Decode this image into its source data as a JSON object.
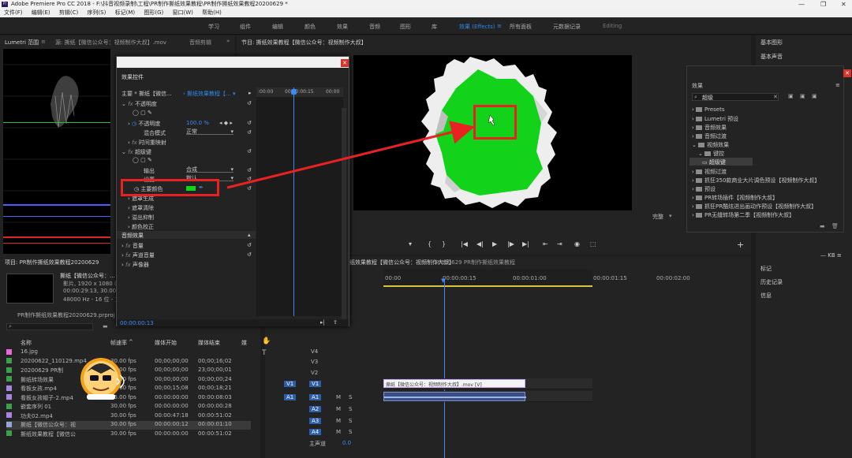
{
  "window": {
    "app": "Adobe Premiere Pro CC 2018",
    "path": "F:\\抖音视频录制\\工程\\PR制作撕纸效果教程\\PR制作撕纸效果教程20200629 *"
  },
  "menu": [
    "文件(F)",
    "编辑(E)",
    "剪辑(C)",
    "序列(S)",
    "标记(M)",
    "图形(G)",
    "窗口(W)",
    "帮助(H)"
  ],
  "workspaces": [
    "学习",
    "组件",
    "编辑",
    "颜色",
    "效果",
    "音频",
    "图形",
    "库",
    "效果 (Effects)",
    "所有面板",
    "元数据记录",
    "Editing"
  ],
  "workspace_active": "效果 (Effects)",
  "left_panel": {
    "tab_scope": "Lumetri 范围",
    "tab_source": "源: 撕纸【微信公众号：视频制作大叔】.mov",
    "tab_audio_mixer": "音频剪辑"
  },
  "program_monitor": {
    "tab": "节目: 撕纸效果教程【微信公众号：视频制作大叔】",
    "quality": "完整"
  },
  "right_panel": {
    "basic_graphics": "基本图形",
    "basic_sound": "基本声音",
    "markers": "标记",
    "history": "历史记录",
    "info": "信息",
    "kb": "KB"
  },
  "effect_controls": {
    "title": "效果控件",
    "master": "主要 * 撕纸【微信...",
    "sequence": "撕纸效果教程【...",
    "ruler_start": ":00:00",
    "ruler_mid": "00:00:00:15",
    "ruler_end": "00:00",
    "rows": {
      "opacity": "不透明度",
      "opacity_label": "不透明度",
      "opacity_value": "100.0 %",
      "blend": "混合模式",
      "blend_value": "正常",
      "time_remap": "时间重映射",
      "ultra_key": "超级键",
      "output": "输出",
      "output_value": "合成",
      "settings": "设置",
      "settings_value": "默认",
      "key_color": "主要颜色",
      "matte_gen": "遮罩生成",
      "matte_clean": "遮罩清除",
      "spill": "溢出抑制",
      "color_correct": "颜色校正",
      "audio_fx": "音频效果",
      "volume": "音量",
      "channel_volume": "声道音量",
      "panner": "声像器"
    },
    "timecode": "00:00:00:13"
  },
  "effects_panel": {
    "title": "效果",
    "search_value": "超级",
    "items": [
      "Presets",
      "Lumetri 预设",
      "音频效果",
      "音频过渡",
      "视频效果",
      "键控",
      "超级键",
      "视频过渡",
      "抓狂350款商业大片调色预设【视频制作大叔】",
      "预设",
      "PR转场插件【视频制作大叔】",
      "抓狂PR酷炫进出画动作预设【视频制作大叔】",
      "PR无缝转场第二季【视频制作大叔】"
    ]
  },
  "project": {
    "tab": "项目: PR制作撕纸效果教程20200629",
    "clip_name": "撕纸【微信公众号：...",
    "clip_info1": "影片, 1920 x 1080 (1.0)",
    "clip_info2": "00:00:29:13, 30.00p",
    "clip_info3": "48000 Hz - 16 位 - 立体",
    "prproj": "PR制作撕纸效果教程20200629.prproj",
    "col_name": "名称",
    "col_fps": "帧速率",
    "col_start": "媒体开始",
    "col_end": "媒体结束",
    "col_more": "媒",
    "rows": [
      {
        "color": "#e86ad6",
        "name": "16.jpg",
        "fps": "",
        "start": "",
        "end": ""
      },
      {
        "color": "#3aa04a",
        "name": "20200622_110129.mp4",
        "fps": "30.00 fps",
        "start": "00;00;00;00",
        "end": "00;00;16;02"
      },
      {
        "color": "#3aa04a",
        "name": "20200629 PR制",
        "fps": "30.00 fps",
        "start": "00;00;00;00",
        "end": "23;00;00;01"
      },
      {
        "color": "#3aa04a",
        "name": "撕纸转场效果",
        "fps": "30.00 fps",
        "start": "00;00;00;00",
        "end": "00;00;00;24"
      },
      {
        "color": "#a884e0",
        "name": "看板女孩.mp4",
        "fps": "30.00 fps",
        "start": "00;00;15;08",
        "end": "00;00;18;21"
      },
      {
        "color": "#a884e0",
        "name": "看板女孩帽子-2.mp4",
        "fps": "25.00 fps",
        "start": "00:00:00:00",
        "end": "00:00:08:03"
      },
      {
        "color": "#3aa04a",
        "name": "嵌套序列 01",
        "fps": "30.00 fps",
        "start": "00:00:00:00",
        "end": "00:00:00:28"
      },
      {
        "color": "#a884e0",
        "name": "功夫02.mp4",
        "fps": "30.00 fps",
        "start": "00:00:47:18",
        "end": "00:00:51:02"
      },
      {
        "color": "#8fa8d8",
        "name": "撕纸【微信公众号：视",
        "fps": "30.00 fps",
        "start": "00:00:00:12",
        "end": "00:00:01:10"
      },
      {
        "color": "#3aa04a",
        "name": "撕纸效果教程【微信公",
        "fps": "30.00 fps",
        "start": "00:00:00:00",
        "end": "00:00:51:02"
      }
    ]
  },
  "timeline": {
    "tab1": "撕纸效果教程【微信公众号：视频制作大叔】",
    "tab2": "20200629 PR制作撕纸效果教程",
    "ruler": [
      "00:00",
      "00:00:00:15",
      "00:00:01:00",
      "00:00:01:15",
      "00:00:02:00"
    ],
    "tracks_video": [
      "V4",
      "V3",
      "V2",
      "V1"
    ],
    "tracks_audio": [
      "A1",
      "A2",
      "A3",
      "A4"
    ],
    "master": "主声道",
    "master_value": "0.0",
    "clip_label": "撕纸【微信公众号：视频制作大叔】.mov [V]",
    "mute": "M",
    "solo": "S"
  },
  "colors": {
    "accent_blue": "#2d8ceb",
    "key_green": "#12d21a",
    "highlight_red": "#e82222"
  }
}
